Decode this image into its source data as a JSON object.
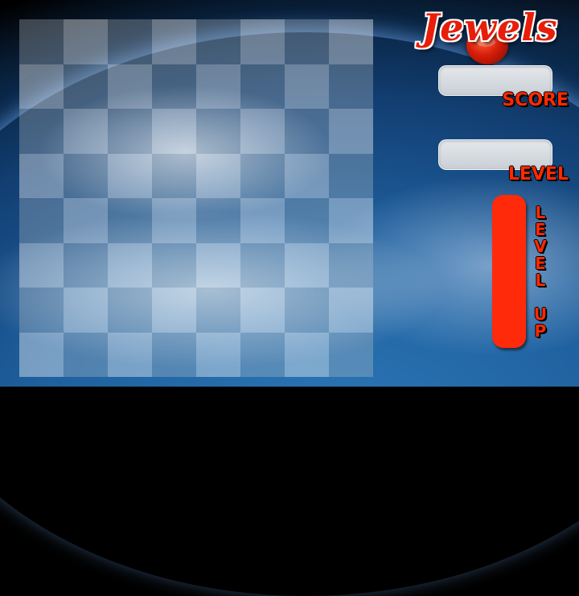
{
  "game": {
    "title": "Jewels"
  },
  "board": {
    "rows": 8,
    "columns": 8
  },
  "hud": {
    "score_label": "SCORE",
    "score_value": "",
    "level_label": "LEVEL",
    "level_value": "",
    "level_up_label": "LEVEL UP",
    "level_up_progress": 1.0
  },
  "colors": {
    "accent": "#ff2a00",
    "meter": "#ff2a0a",
    "field": "#d8dde2"
  }
}
